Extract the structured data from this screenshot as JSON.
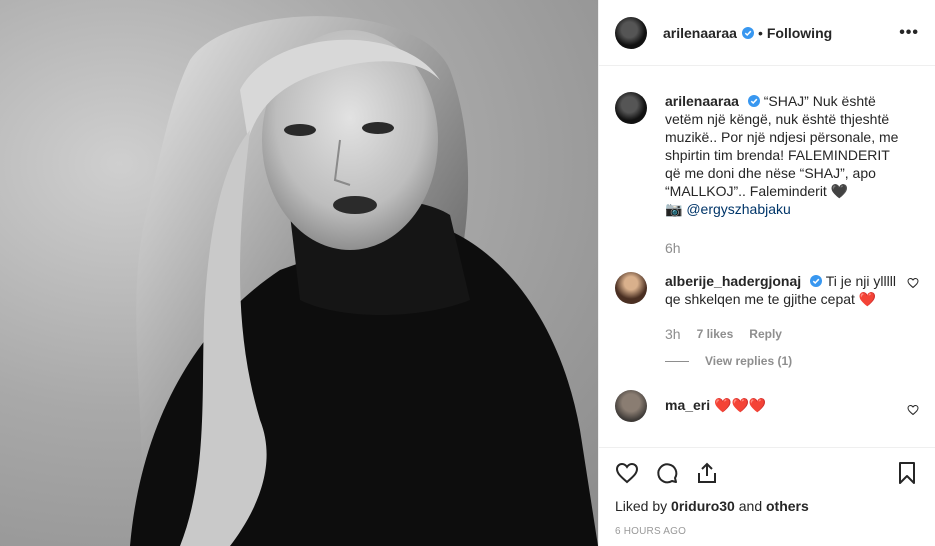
{
  "photo": {
    "alt": ""
  },
  "header": {
    "username": "arilenaaraa",
    "separator": "•",
    "follow_status": "Following",
    "more": "•••"
  },
  "caption": {
    "username": "arilenaaraa",
    "title": "“SHAJ”",
    "body": "Nuk është vetëm një këngë, nuk është thjeshtë muzikë.. Por një ndjesi përsonale, me shpirtin tim brenda! FALEMINDERIT që me doni dhe nëse “SHAJ”, apo “MALLKOJ”.. Faleminderit",
    "heart": "🖤",
    "camera": "📷",
    "mention": "@ergyszhabjaku",
    "time": "6h"
  },
  "comments": [
    {
      "username": "alberije_hadergjonaj",
      "text": "Ti je nji ylllll qe shkelqen me te gjithe cepat",
      "emoji": "❤️",
      "time": "3h",
      "likes": "7 likes",
      "reply": "Reply",
      "view_replies": "View replies (1)"
    },
    {
      "username": "ma_eri",
      "emoji": "❤️❤️❤️"
    }
  ],
  "footer": {
    "liked_by_prefix": "Liked by",
    "liked_by_user": "0riduro30",
    "liked_by_and": "and",
    "liked_by_others": "others",
    "posted_ago": "6 HOURS AGO"
  },
  "colors": {
    "verified": "#3897f0",
    "heart": "#ed4956",
    "link": "#003569",
    "muted": "#8e8e8e"
  }
}
